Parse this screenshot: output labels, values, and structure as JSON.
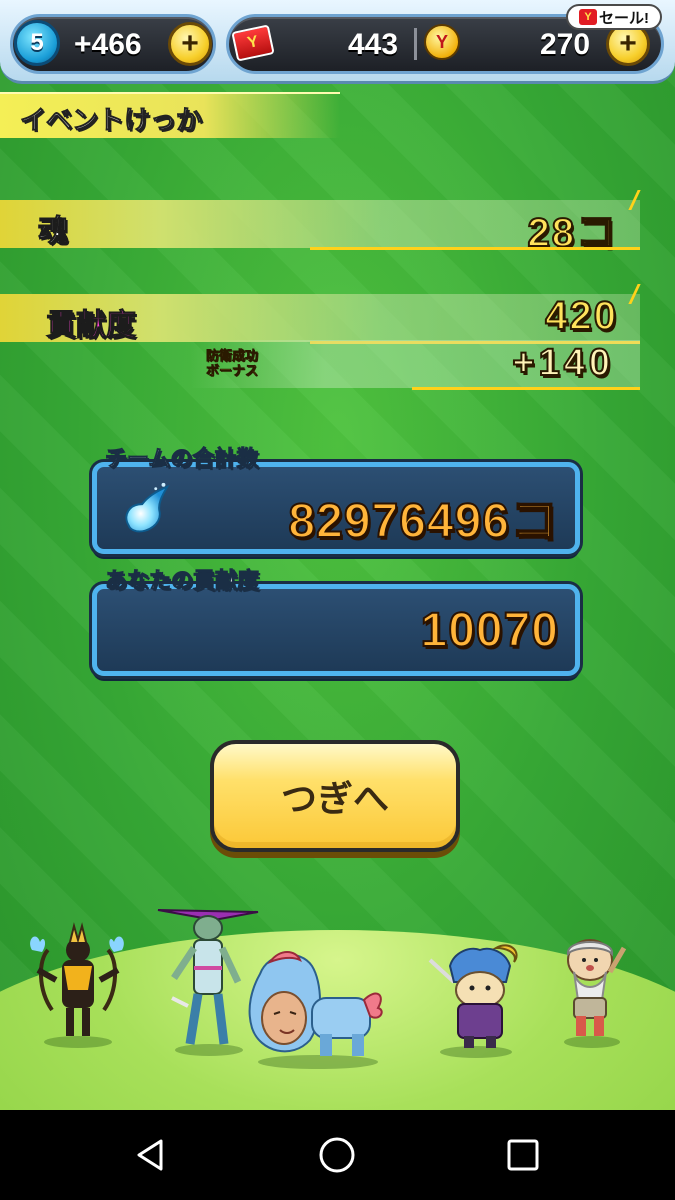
{
  "status_bar": {
    "level": "5",
    "stamina_plus": "+466",
    "tickets": "443",
    "coins": "270",
    "sale_label": "セール!",
    "sale_mini_icon": "Y"
  },
  "banner": {
    "title": "イベントけっか"
  },
  "stats": {
    "soul_label": "魂",
    "soul_value": "28コ",
    "contribution_label": "貢献度",
    "contribution_value": "420",
    "bonus_label_line1": "防衛成功",
    "bonus_label_line2": "ボーナス",
    "bonus_value": "+140"
  },
  "team_panel": {
    "title": "チームの合計数",
    "value": "82976496コ"
  },
  "your_panel": {
    "title": "あなたの貢献度",
    "value": "10070"
  },
  "next_button": {
    "label": "つぎへ"
  },
  "icons": {
    "level": "level-badge-icon",
    "plus": "plus-icon",
    "ticket": "ticket-icon",
    "coin": "coin-icon",
    "soul": "soul-icon"
  },
  "colors": {
    "background_green": "#36a835",
    "value_gold": "#ffe25c",
    "panel_blue": "#1e3a57",
    "panel_border": "#4fb3ee",
    "button_yellow": "#ffe06a",
    "contribution_pink": "#ff46d4"
  }
}
